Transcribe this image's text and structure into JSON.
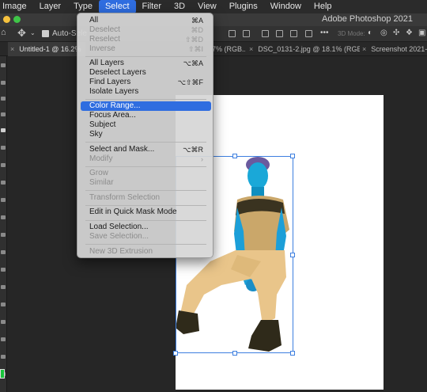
{
  "menubar": {
    "items": [
      "Image",
      "Layer",
      "Type",
      "Select",
      "Filter",
      "3D",
      "View",
      "Plugins",
      "Window",
      "Help"
    ],
    "active": "Select"
  },
  "window": {
    "title": "Adobe Photoshop 2021",
    "traffic_colors": [
      "#f6c23e",
      "#3fc548"
    ]
  },
  "options_bar": {
    "auto_select_label": "Auto-Sele",
    "more_label": "•••",
    "mode_label": "3D Mode:"
  },
  "tabs": [
    {
      "close": "×",
      "label": "Untitled-1 @ 16.2%"
    },
    {
      "close": "",
      "label": "7% (RGB..."
    },
    {
      "close": "×",
      "label": "DSC_0131-2.jpg @ 18.1% (RGB..."
    },
    {
      "close": "×",
      "label": "Screenshot 2021-0"
    }
  ],
  "select_menu": {
    "items": [
      {
        "label": "All",
        "shortcut": "⌘A",
        "disabled": false
      },
      {
        "label": "Deselect",
        "shortcut": "⌘D",
        "disabled": true
      },
      {
        "label": "Reselect",
        "shortcut": "⇧⌘D",
        "disabled": true
      },
      {
        "label": "Inverse",
        "shortcut": "⇧⌘I",
        "disabled": true
      },
      {
        "label": "All Layers",
        "shortcut": "⌥⌘A",
        "disabled": false
      },
      {
        "label": "Deselect Layers",
        "shortcut": "",
        "disabled": false
      },
      {
        "label": "Find Layers",
        "shortcut": "⌥⇧⌘F",
        "disabled": false
      },
      {
        "label": "Isolate Layers",
        "shortcut": "",
        "disabled": false
      },
      {
        "label": "Color Range...",
        "shortcut": "",
        "disabled": false,
        "highlighted": true
      },
      {
        "label": "Focus Area...",
        "shortcut": "",
        "disabled": false
      },
      {
        "label": "Subject",
        "shortcut": "",
        "disabled": false
      },
      {
        "label": "Sky",
        "shortcut": "",
        "disabled": false
      },
      {
        "label": "Select and Mask...",
        "shortcut": "⌥⌘R",
        "disabled": false
      },
      {
        "label": "Modify",
        "shortcut": "›",
        "disabled": true
      },
      {
        "label": "Grow",
        "shortcut": "",
        "disabled": true
      },
      {
        "label": "Similar",
        "shortcut": "",
        "disabled": true
      },
      {
        "label": "Transform Selection",
        "shortcut": "",
        "disabled": true
      },
      {
        "label": "Edit in Quick Mask Mode",
        "shortcut": "",
        "disabled": false
      },
      {
        "label": "Load Selection...",
        "shortcut": "",
        "disabled": false
      },
      {
        "label": "Save Selection...",
        "shortcut": "",
        "disabled": true
      },
      {
        "label": "New 3D Extrusion",
        "shortcut": "",
        "disabled": true
      }
    ]
  },
  "colors": {
    "accent": "#2f6de0",
    "foreground_color": "#17c43a",
    "selection_box": "#3d7fe0"
  }
}
